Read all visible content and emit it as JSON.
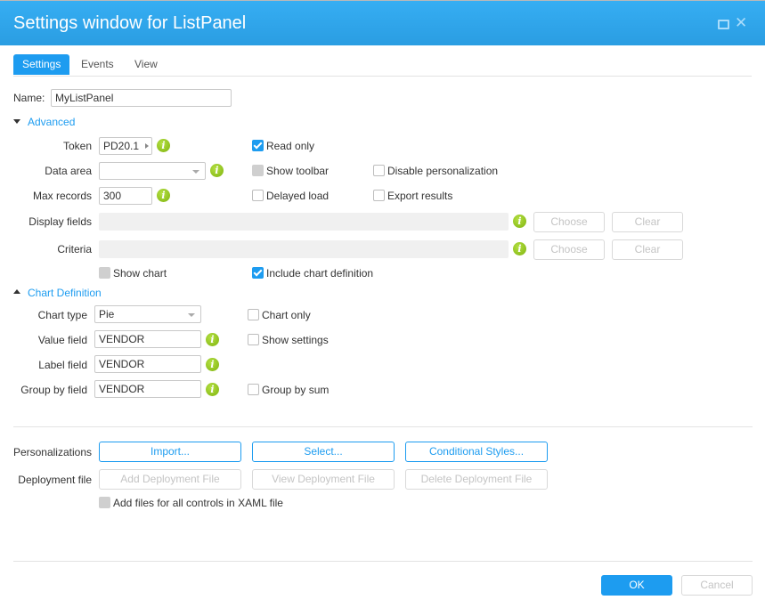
{
  "window": {
    "title": "Settings window for ListPanel",
    "maximize_icon": "maximize-icon",
    "close_icon": "close-icon"
  },
  "tabs": [
    {
      "label": "Settings",
      "active": true
    },
    {
      "label": "Events",
      "active": false
    },
    {
      "label": "View",
      "active": false
    }
  ],
  "name_field": {
    "label": "Name:",
    "value": "MyListPanel"
  },
  "advanced": {
    "section_label": "Advanced",
    "expanded": true,
    "token": {
      "label": "Token",
      "value": "PD20.1"
    },
    "data_area": {
      "label": "Data area",
      "value": ""
    },
    "max_records": {
      "label": "Max records",
      "value": "300"
    },
    "display_fields": {
      "label": "Display fields",
      "value": "",
      "choose_label": "Choose",
      "clear_label": "Clear"
    },
    "criteria": {
      "label": "Criteria",
      "value": "",
      "choose_label": "Choose",
      "clear_label": "Clear"
    },
    "checkboxes": {
      "read_only": {
        "label": "Read only",
        "checked": true
      },
      "show_toolbar": {
        "label": "Show toolbar",
        "checked": false,
        "disabled": true
      },
      "disable_personalization": {
        "label": "Disable personalization",
        "checked": false
      },
      "delayed_load": {
        "label": "Delayed load",
        "checked": false
      },
      "export_results": {
        "label": "Export results",
        "checked": false
      },
      "show_chart": {
        "label": "Show chart",
        "checked": false,
        "disabled": true
      },
      "include_chart_definition": {
        "label": "Include chart definition",
        "checked": true
      }
    }
  },
  "chart_definition": {
    "section_label": "Chart Definition",
    "expanded": true,
    "chart_type": {
      "label": "Chart type",
      "value": "Pie"
    },
    "value_field": {
      "label": "Value field",
      "value": "VENDOR"
    },
    "label_field": {
      "label": "Label field",
      "value": "VENDOR"
    },
    "group_by_field": {
      "label": "Group by field",
      "value": "VENDOR"
    },
    "checkboxes": {
      "chart_only": {
        "label": "Chart only",
        "checked": false
      },
      "show_settings": {
        "label": "Show settings",
        "checked": false
      },
      "group_by_sum": {
        "label": "Group by sum",
        "checked": false
      }
    }
  },
  "personalizations": {
    "label": "Personalizations",
    "import_label": "Import...",
    "select_label": "Select...",
    "conditional_styles_label": "Conditional Styles..."
  },
  "deployment": {
    "label": "Deployment file",
    "add_label": "Add Deployment File",
    "view_label": "View Deployment File",
    "delete_label": "Delete Deployment File",
    "add_all_controls": {
      "label": "Add files for all controls in XAML file",
      "checked": false,
      "disabled": true
    }
  },
  "footer": {
    "ok_label": "OK",
    "cancel_label": "Cancel"
  },
  "colors": {
    "accent": "#1d9cf0",
    "title_bar": "#2fa6ec",
    "info_icon": "#8cc11a"
  }
}
